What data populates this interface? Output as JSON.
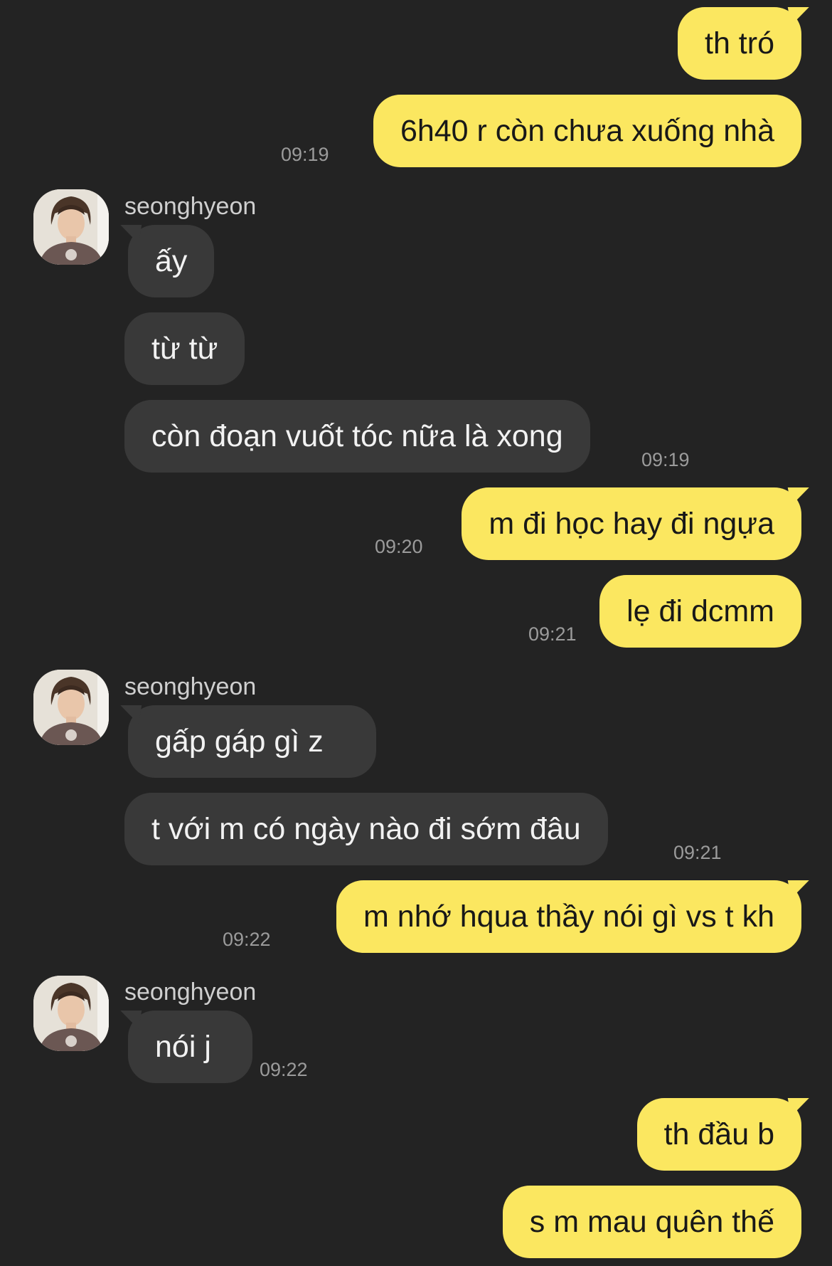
{
  "contact": {
    "name": "seonghyeon"
  },
  "messages": [
    {
      "text": "th tró",
      "time": ""
    },
    {
      "text": "6h40 r còn chưa xuống nhà",
      "time": "09:19"
    },
    {
      "text": "ấy",
      "time": ""
    },
    {
      "text": "từ từ",
      "time": ""
    },
    {
      "text": "còn đoạn vuốt tóc nữa là xong",
      "time": "09:19"
    },
    {
      "text": "m đi học hay đi ngựa",
      "time": "09:20"
    },
    {
      "text": "lẹ đi dcmm",
      "time": "09:21"
    },
    {
      "text": "gấp gáp gì z",
      "time": ""
    },
    {
      "text": "t với m có ngày nào đi sớm đâu",
      "time": "09:21"
    },
    {
      "text": "m nhớ hqua thầy nói gì vs t kh",
      "time": "09:22"
    },
    {
      "text": "nói j",
      "time": "09:22"
    },
    {
      "text": "th đầu b",
      "time": ""
    },
    {
      "text": "s m mau quên thế",
      "time": ""
    }
  ],
  "colors": {
    "background": "#232323",
    "sent_bubble": "#fbe760",
    "received_bubble": "#393939"
  }
}
